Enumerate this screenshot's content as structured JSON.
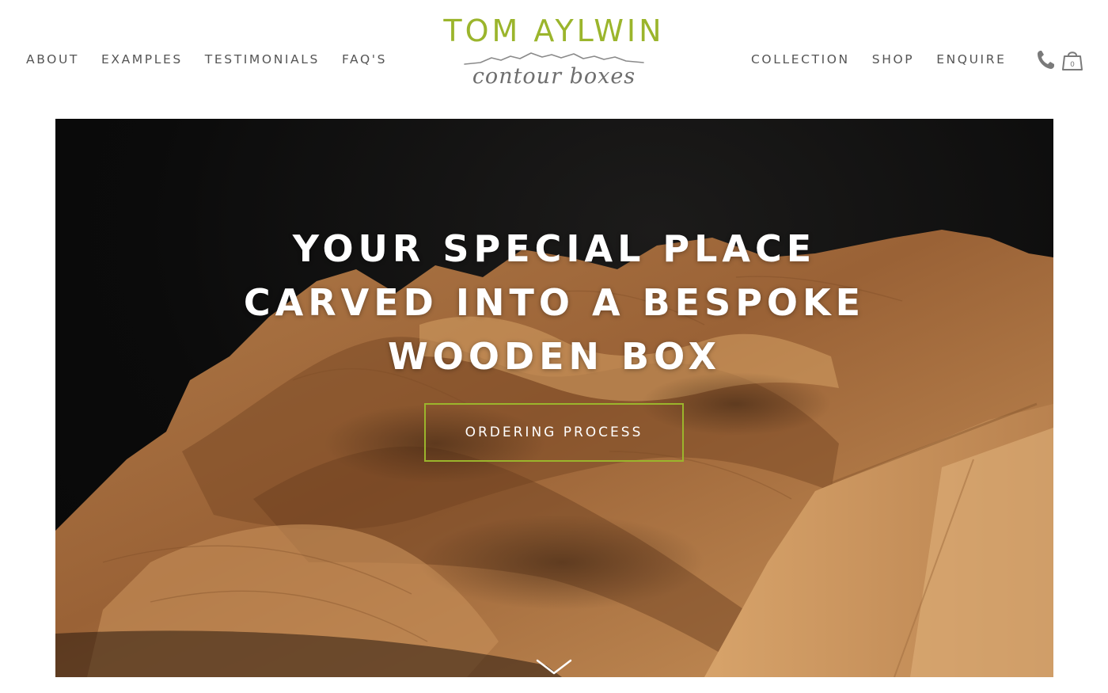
{
  "header": {
    "nav_left": [
      {
        "label": "ABOUT"
      },
      {
        "label": "EXAMPLES"
      },
      {
        "label": "TESTIMONIALS"
      },
      {
        "label": "FAQ'S"
      }
    ],
    "nav_right": [
      {
        "label": "COLLECTION"
      },
      {
        "label": "SHOP"
      },
      {
        "label": "ENQUIRE"
      }
    ],
    "logo": {
      "name": "TOM AYLWIN",
      "tagline": "contour boxes"
    },
    "icons": {
      "phone": "phone-icon",
      "basket": "shopping-bag-icon",
      "basket_count": "0"
    }
  },
  "hero": {
    "title_lines": [
      "YOUR SPECIAL PLACE",
      "CARVED INTO A BESPOKE",
      "WOODEN BOX"
    ],
    "cta_label": "ORDERING PROCESS",
    "scroll_icon": "chevron-down-icon"
  },
  "colors": {
    "accent_green": "#9bb52c",
    "nav_text": "#555555",
    "tagline": "#6e6e6e",
    "hero_text": "#ffffff",
    "hero_bg": "#0b0b0b"
  }
}
